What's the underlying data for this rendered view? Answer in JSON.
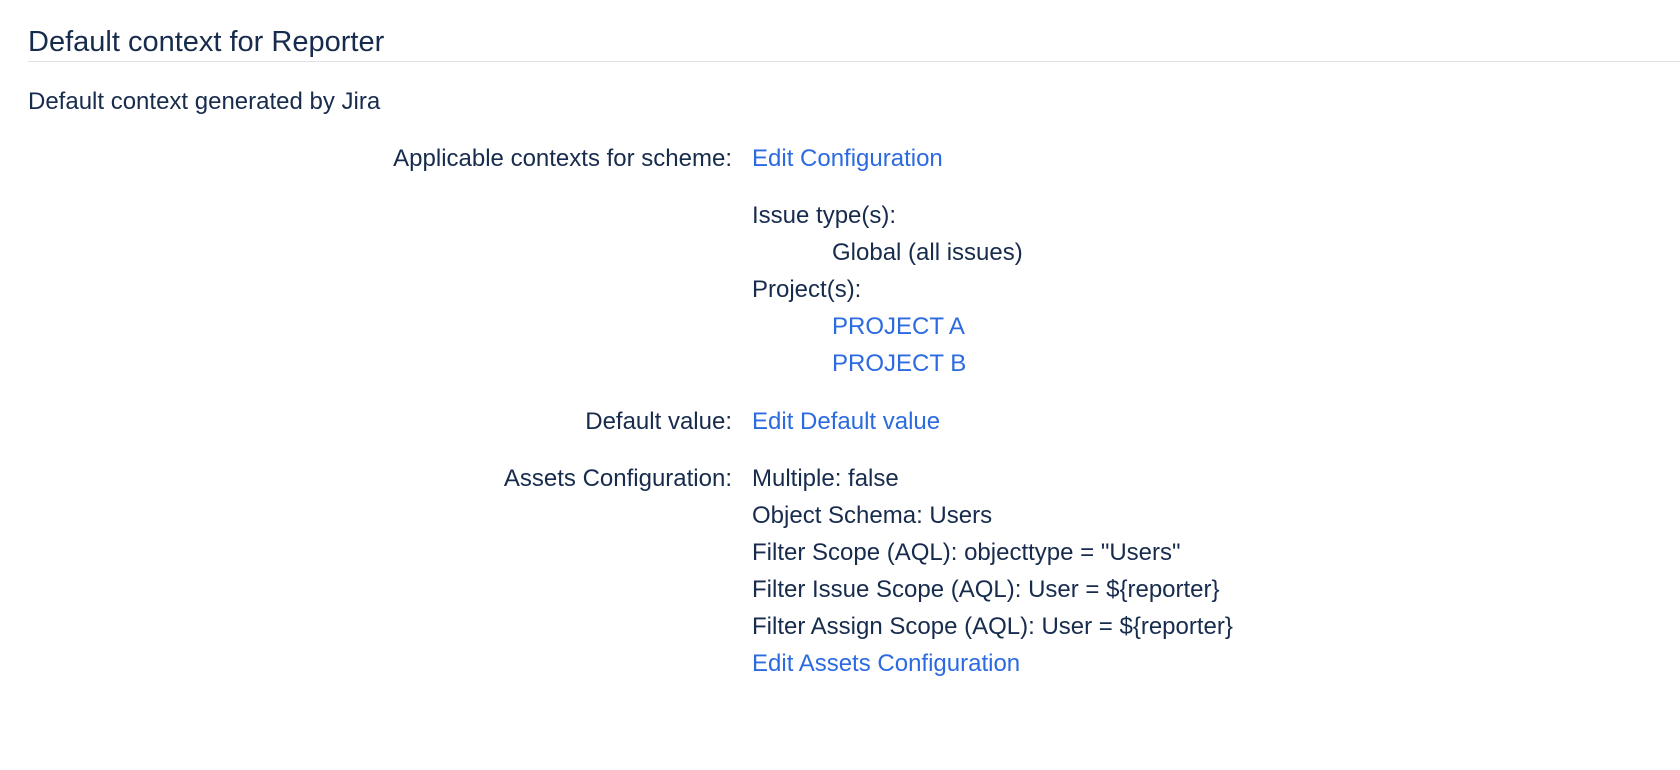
{
  "header": {
    "title": "Default context for Reporter"
  },
  "context": {
    "description": "Default context generated by Jira",
    "applicable": {
      "label": "Applicable contexts for scheme:",
      "edit_link": "Edit Configuration",
      "issue_types_label": "Issue type(s):",
      "issue_types": [
        "Global (all issues)"
      ],
      "projects_label": "Project(s):",
      "projects": [
        "PROJECT A",
        "PROJECT B"
      ]
    },
    "default_value": {
      "label": "Default value:",
      "edit_link": "Edit Default value"
    },
    "assets": {
      "label": "Assets Configuration:",
      "lines": [
        "Multiple: false",
        "Object Schema: Users",
        "Filter Scope (AQL): objecttype = \"Users\"",
        "Filter Issue Scope (AQL): User = ${reporter}",
        "Filter Assign Scope (AQL): User = ${reporter}"
      ],
      "edit_link": "Edit Assets Configuration"
    }
  }
}
